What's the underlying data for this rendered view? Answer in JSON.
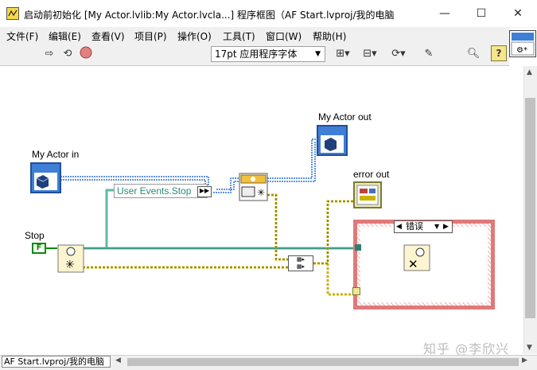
{
  "window": {
    "title": "启动前初始化 [My Actor.lvlib:My Actor.lvcla...] 程序框图（AF Start.lvproj/我的电脑",
    "minimize": "—",
    "maximize": "☐",
    "close": "✕"
  },
  "menu": [
    "文件(F)",
    "编辑(E)",
    "查看(V)",
    "项目(P)",
    "操作(O)",
    "工具(T)",
    "窗口(W)",
    "帮助(H)"
  ],
  "toolbar": {
    "font": "17pt 应用程序字体",
    "help": "?"
  },
  "diagram": {
    "actor_in_label": "My Actor in",
    "actor_out_label": "My Actor out",
    "error_out_label": "error out",
    "stop_label": "Stop",
    "stop_constant": "F",
    "bundle_label": "User Events.Stop",
    "case_selector": "错误"
  },
  "status_bar": {
    "path": "AF Start.lvproj/我的电脑"
  },
  "watermark": "知乎 @李欣兴",
  "colors": {
    "class_wire": "#2b6fd6",
    "event_wire": "#5fb8a8",
    "error_wire": "#c8b400",
    "case_border": "#e07a7a",
    "bool_green": "#0a8a0a"
  }
}
